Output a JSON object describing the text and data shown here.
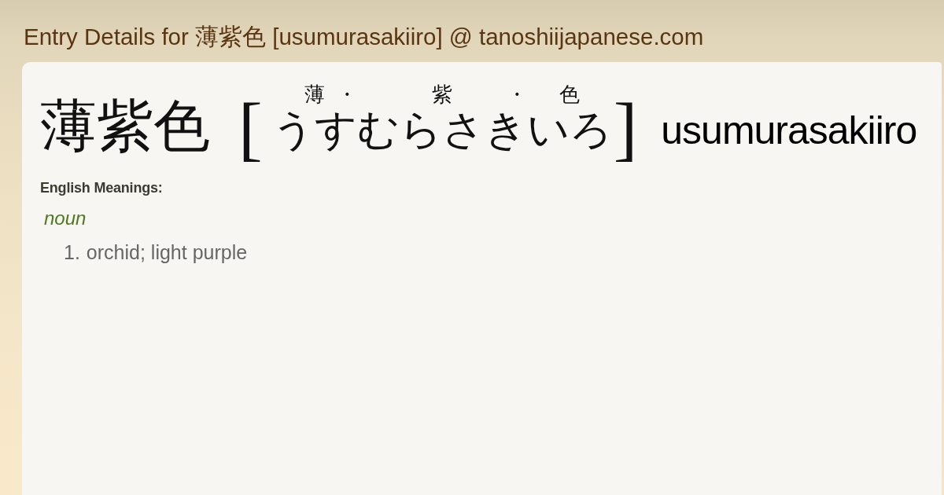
{
  "page_title": "Entry Details for 薄紫色 [usumurasakiiro] @ tanoshiijapanese.com",
  "entry": {
    "headword": "薄紫色",
    "bracket_open": "[",
    "reading": [
      {
        "kanji": "薄",
        "kana": "うす",
        "separator": "・"
      },
      {
        "kanji": "紫",
        "kana": "むらさき",
        "separator": "・"
      },
      {
        "kanji": "色",
        "kana": "いろ"
      }
    ],
    "bracket_close": "]",
    "romaji": "usumurasakiiro"
  },
  "meanings_heading": "English Meanings:",
  "meaning_groups": [
    {
      "part_of_speech": "noun",
      "senses": [
        {
          "number": "1.",
          "text": "orchid; light purple"
        }
      ]
    }
  ]
}
